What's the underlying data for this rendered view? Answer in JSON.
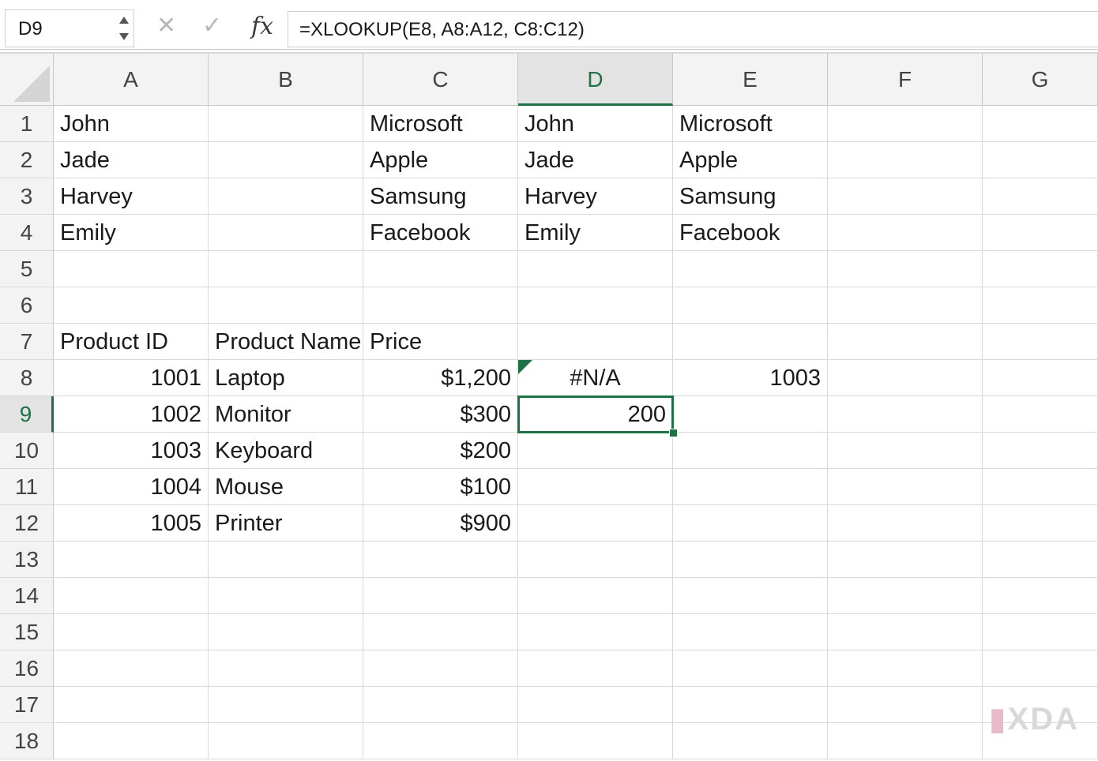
{
  "formula_bar": {
    "name_box": "D9",
    "cancel_icon": "close-icon",
    "confirm_icon": "checkmark-icon",
    "fx_label": "fx",
    "formula": "=XLOOKUP(E8, A8:A12, C8:C12)"
  },
  "grid": {
    "columns": [
      "A",
      "B",
      "C",
      "D",
      "E",
      "F",
      "G"
    ],
    "rows": [
      "1",
      "2",
      "3",
      "4",
      "5",
      "6",
      "7",
      "8",
      "9",
      "10",
      "11",
      "12",
      "13",
      "14",
      "15",
      "16",
      "17",
      "18"
    ],
    "active_cell": "D9",
    "cells": {
      "A1": "John",
      "C1": "Microsoft",
      "D1": "John",
      "E1": "Microsoft",
      "A2": "Jade",
      "C2": "Apple",
      "D2": "Jade",
      "E2": "Apple",
      "A3": "Harvey",
      "C3": "Samsung",
      "D3": "Harvey",
      "E3": "Samsung",
      "A4": "Emily",
      "C4": "Facebook",
      "D4": "Emily",
      "E4": "Facebook",
      "A7": "Product ID",
      "B7": "Product Name",
      "C7": "Price",
      "A8": "1001",
      "B8": "Laptop",
      "C8": "$1,200",
      "D8": "#N/A",
      "E8": "1003",
      "A9": "1002",
      "B9": "Monitor",
      "C9": "$300",
      "D9": "200",
      "A10": "1003",
      "B10": "Keyboard",
      "C10": "$200",
      "A11": "1004",
      "B11": "Mouse",
      "C11": "$100",
      "A12": "1005",
      "B12": "Printer",
      "C12": "$900"
    }
  },
  "colors": {
    "accent": "#1e7145",
    "header_bg": "#f3f3f3",
    "gridline": "#d9d9d9"
  }
}
